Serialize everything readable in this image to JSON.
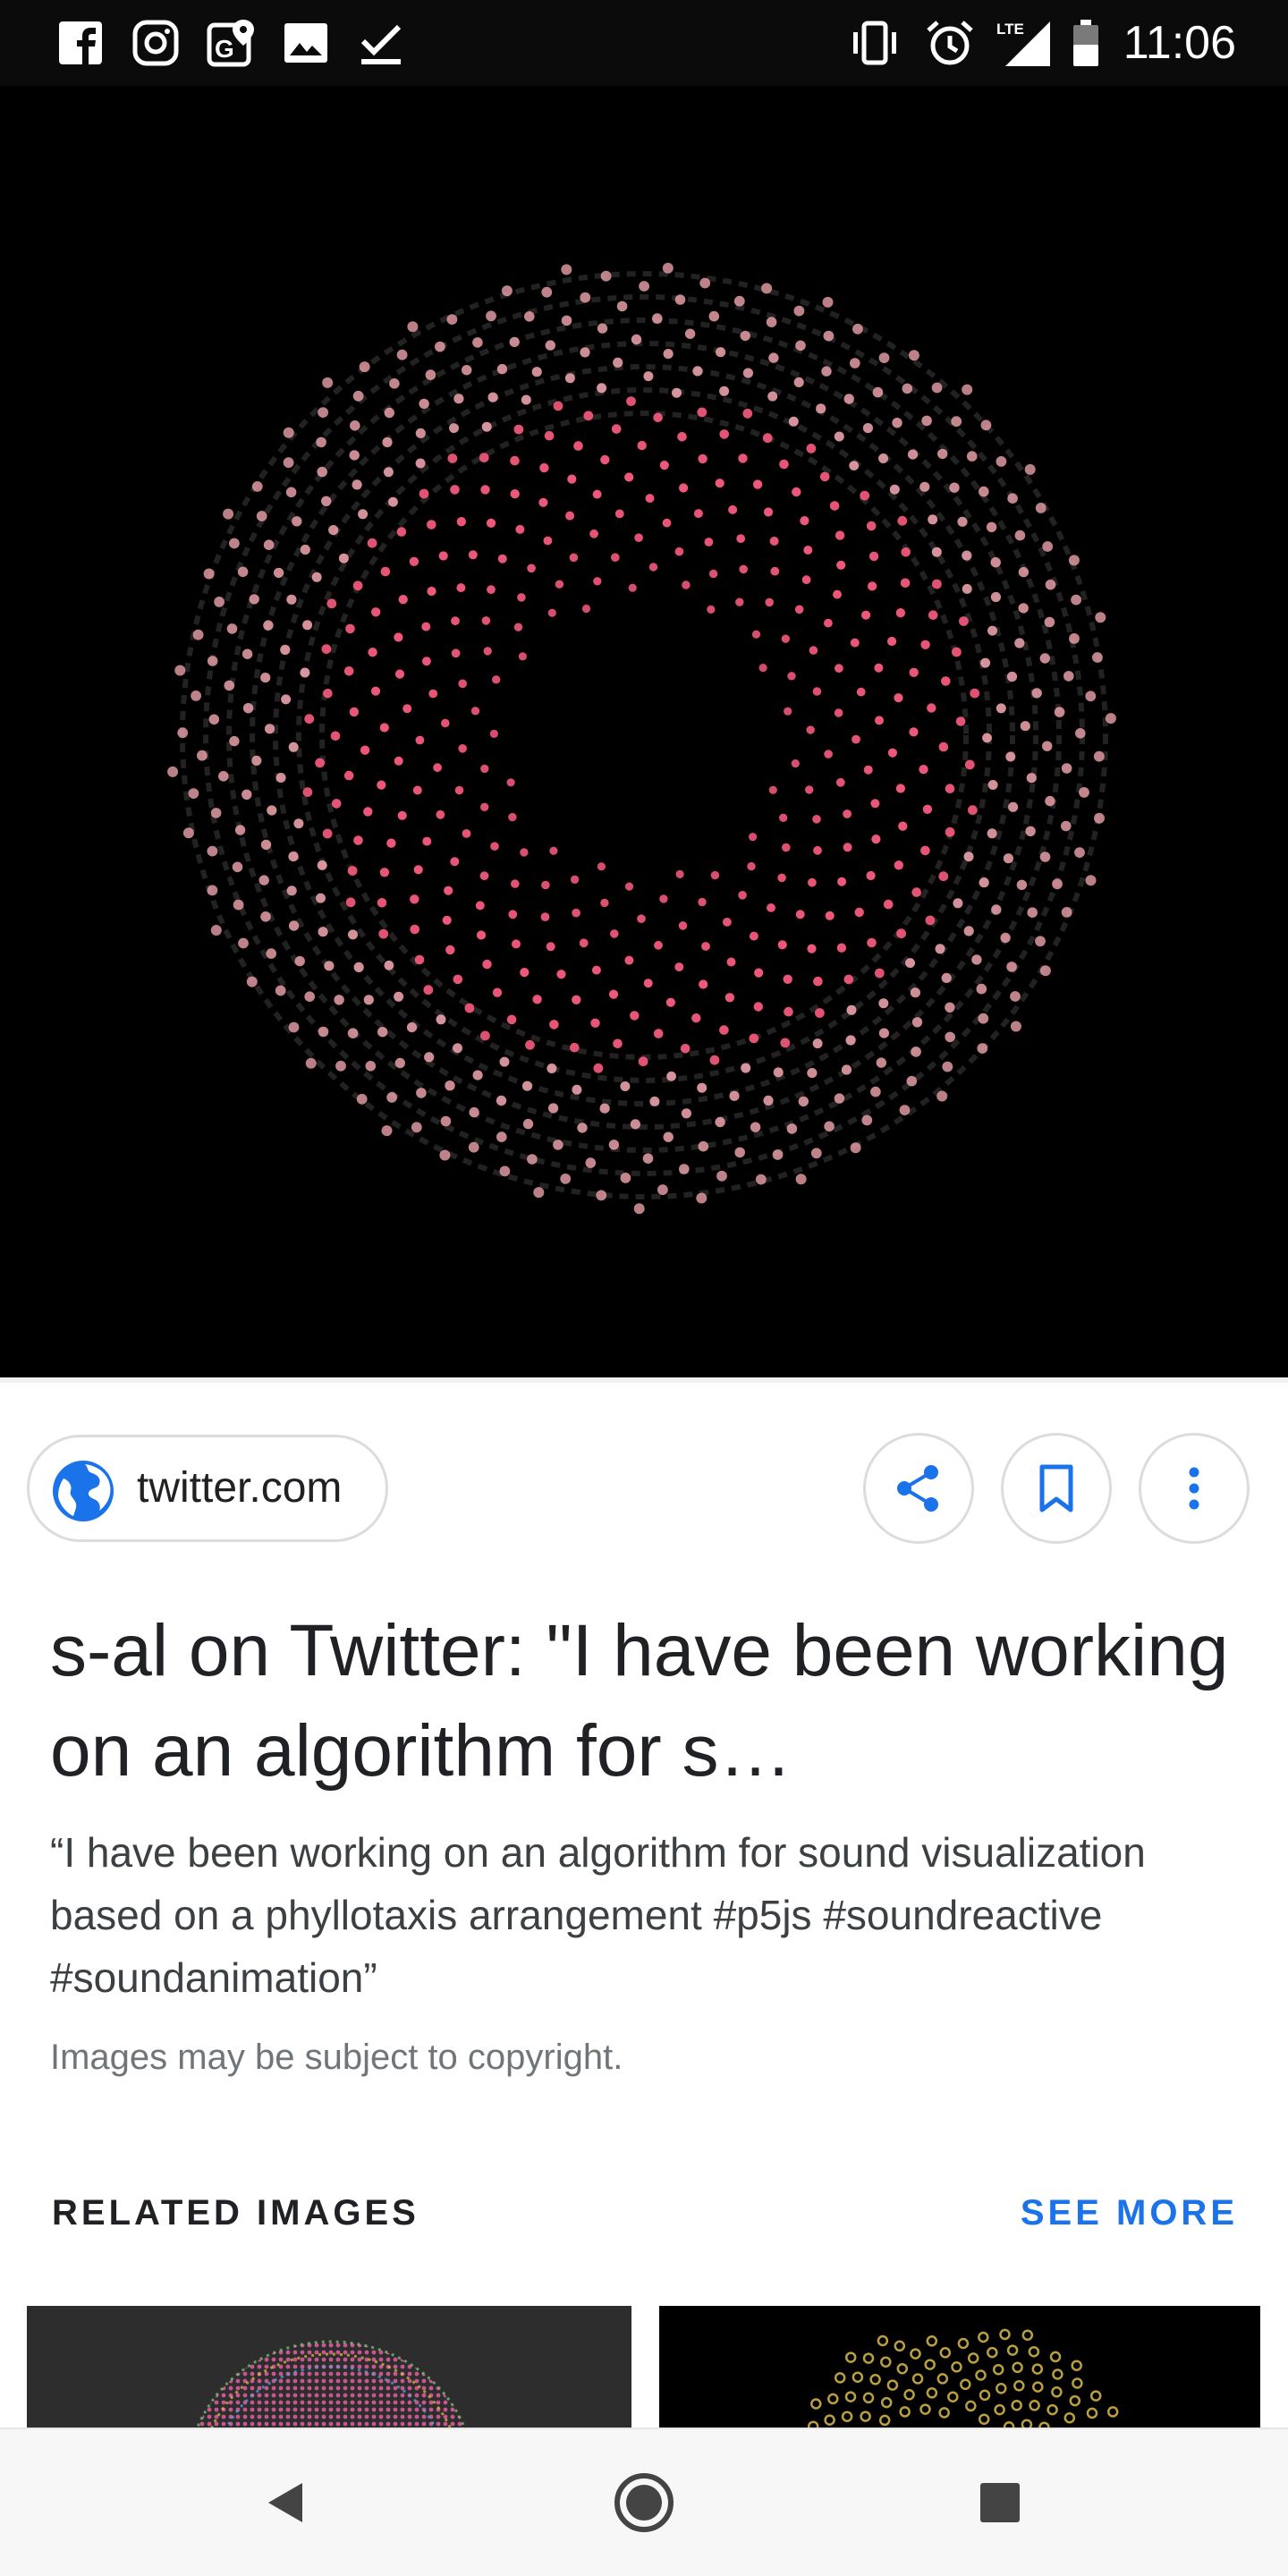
{
  "status_bar": {
    "time": "11:06",
    "network_label": "LTE",
    "left_icons": [
      "facebook-icon",
      "instagram-icon",
      "maps-icon",
      "gallery-icon",
      "checkmark-icon"
    ],
    "right_icons": [
      "vibrate-icon",
      "alarm-icon",
      "signal-icon",
      "battery-icon"
    ]
  },
  "hero_image": {
    "description_icon": "phyllotaxis-visualization"
  },
  "source": {
    "domain": "twitter.com",
    "icon": "globe-icon"
  },
  "actions": {
    "share_icon": "share-icon",
    "bookmark_icon": "bookmark-icon",
    "more_icon": "more-vert-icon"
  },
  "result": {
    "title": "s-al on Twitter: \"I have been working on an algorithm for s…",
    "description": "“I have been working on an algorithm for sound visualization based on a phyllotaxis arrangement #p5js #soundreactive #soundanimation”",
    "copyright_notice": "Images may be subject to copyright."
  },
  "related": {
    "label": "RELATED IMAGES",
    "see_more": "SEE MORE"
  },
  "nav_bar": {
    "back_icon": "back-triangle-icon",
    "home_icon": "home-circle-icon",
    "recents_icon": "recents-square-icon"
  },
  "colors": {
    "accent": "#1a73e8",
    "dot_color": "#f0587a",
    "status_bar_bg": "#0b0b0b"
  }
}
